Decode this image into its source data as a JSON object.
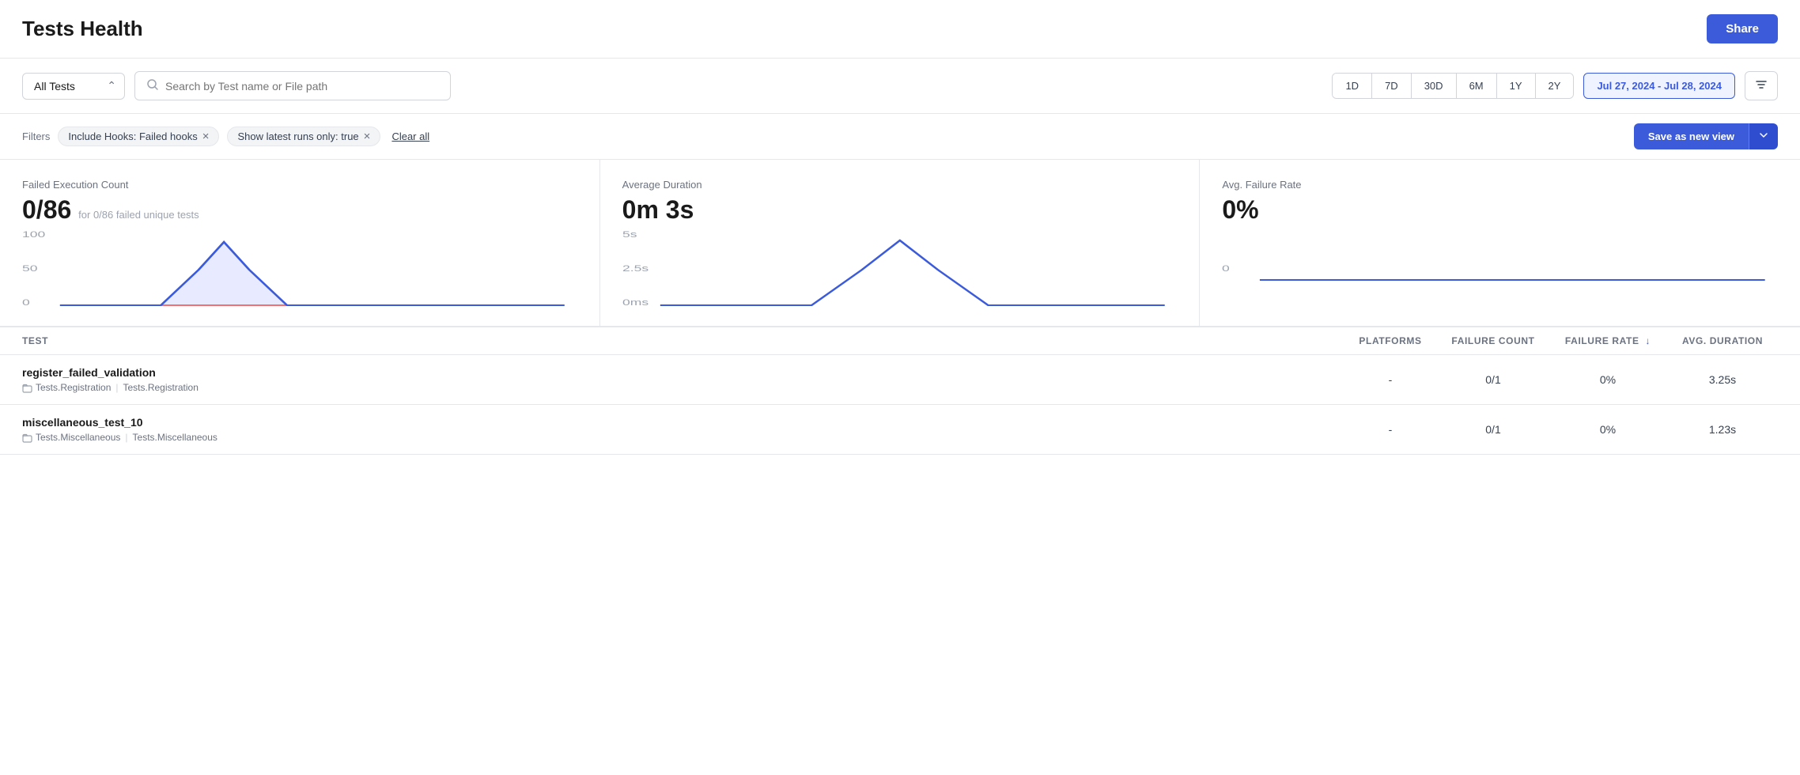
{
  "header": {
    "title": "Tests Health",
    "share_label": "Share"
  },
  "toolbar": {
    "all_tests_label": "All Tests",
    "search_placeholder": "Search by Test name or File path",
    "time_buttons": [
      "1D",
      "7D",
      "30D",
      "6M",
      "1Y",
      "2Y"
    ],
    "date_range": "Jul 27, 2024 - Jul 28, 2024"
  },
  "filters": {
    "label": "Filters",
    "tags": [
      {
        "text": "Include Hooks: Failed hooks"
      },
      {
        "text": "Show latest runs only: true"
      }
    ],
    "clear_all": "Clear all",
    "save_view": "Save as new view"
  },
  "cards": [
    {
      "label": "Failed Execution Count",
      "value": "0/86",
      "sub": "for 0/86 failed unique tests",
      "chart_type": "peak",
      "y_labels": [
        "100",
        "50",
        "0"
      ]
    },
    {
      "label": "Average Duration",
      "value": "0m 3s",
      "sub": "",
      "chart_type": "peak",
      "y_labels": [
        "5s",
        "2.5s",
        "0ms"
      ]
    },
    {
      "label": "Avg. Failure Rate",
      "value": "0%",
      "sub": "",
      "chart_type": "flat",
      "y_labels": [
        "0"
      ]
    }
  ],
  "table": {
    "columns": [
      "TEST",
      "PLATFORMS",
      "FAILURE COUNT",
      "FAILURE RATE",
      "AVG. DURATION"
    ],
    "rows": [
      {
        "name": "register_failed_validation",
        "path1": "Tests.Registration",
        "path2": "Tests.Registration",
        "platforms": "-",
        "failure_count": "0/1",
        "failure_rate": "0%",
        "avg_duration": "3.25s"
      },
      {
        "name": "miscellaneous_test_10",
        "path1": "Tests.Miscellaneous",
        "path2": "Tests.Miscellaneous",
        "platforms": "-",
        "failure_count": "0/1",
        "failure_rate": "0%",
        "avg_duration": "1.23s"
      }
    ]
  }
}
